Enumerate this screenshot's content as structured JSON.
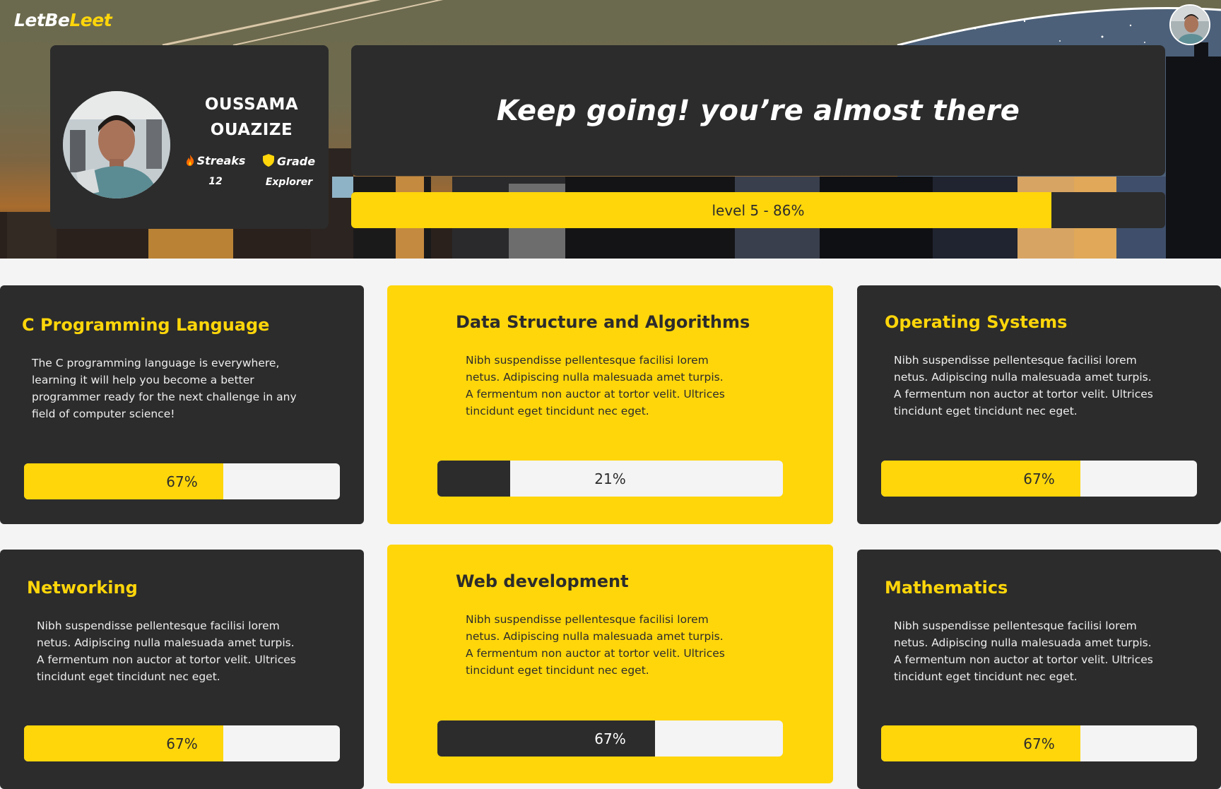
{
  "brand": {
    "part1": "LetBe",
    "part2": "Leet"
  },
  "profile": {
    "first_name": "OUSSAMA",
    "last_name": "OUAZIZE",
    "streaks_label": "Streaks",
    "streaks_value": "12",
    "grade_label": "Grade",
    "grade_value": "Explorer"
  },
  "motto": "Keep going! you’re almost there",
  "level": {
    "label": "level 5 - 86%",
    "progress": 0.86
  },
  "courses": [
    {
      "title": "C Programming Language",
      "description": "The C programming language is everywhere, learning it will help you become a better programmer ready for the next challenge in any field of computer science!",
      "progress_label": "67%",
      "progress": 0.63
    },
    {
      "title": "Data Structure and Algorithms",
      "description": "Nibh suspendisse pellentesque facilisi lorem netus. Adipiscing nulla malesuada amet turpis. A fermentum non auctor at tortor velit. Ultrices tincidunt eget tincidunt nec eget.",
      "progress_label": "21%",
      "progress": 0.21
    },
    {
      "title": "Operating Systems",
      "description": "Nibh suspendisse pellentesque facilisi lorem netus. Adipiscing nulla malesuada amet turpis. A fermentum non auctor at tortor velit. Ultrices tincidunt eget tincidunt nec eget.",
      "progress_label": "67%",
      "progress": 0.63
    },
    {
      "title": "Networking",
      "description": "Nibh suspendisse pellentesque facilisi lorem netus. Adipiscing nulla malesuada amet turpis. A fermentum non auctor at tortor velit. Ultrices tincidunt eget tincidunt nec eget.",
      "progress_label": "67%",
      "progress": 0.63
    },
    {
      "title": "Web development",
      "description": "Nibh suspendisse pellentesque facilisi lorem netus. Adipiscing nulla malesuada amet turpis. A fermentum non auctor at tortor velit. Ultrices tincidunt eget tincidunt nec eget.",
      "progress_label": "67%",
      "progress": 0.63
    },
    {
      "title": "Mathematics",
      "description": "Nibh suspendisse pellentesque facilisi lorem netus. Adipiscing nulla malesuada amet turpis. A fermentum non auctor at tortor velit. Ultrices tincidunt eget tincidunt nec eget.",
      "progress_label": "67%",
      "progress": 0.63
    }
  ],
  "colors": {
    "accent": "#ffd60a",
    "card_dark": "#2c2c2c",
    "page_bg": "#f4f4f4"
  },
  "icons": {
    "streaks": "fire-icon",
    "grade": "shield-icon"
  }
}
